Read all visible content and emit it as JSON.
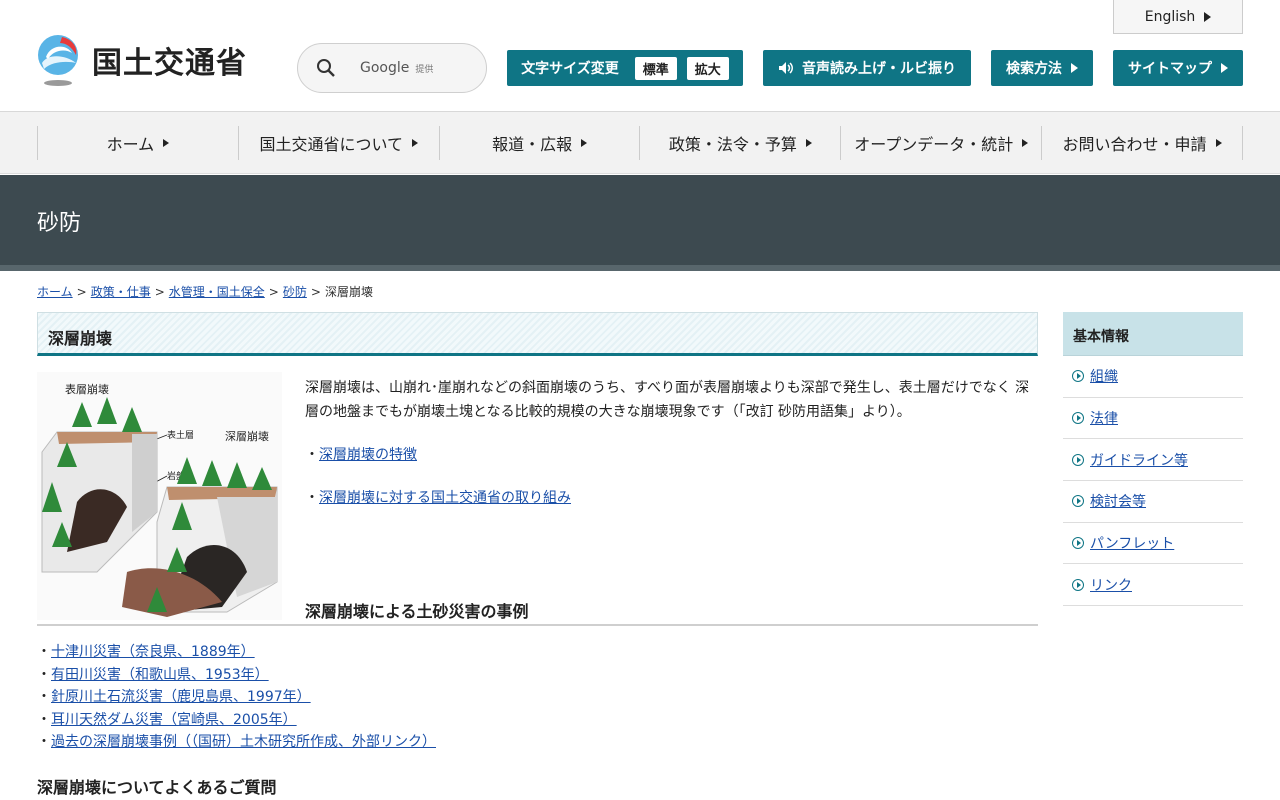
{
  "header": {
    "logo_text": "国土交通省",
    "search": {
      "brand": "Google",
      "provided": "提供"
    },
    "english_label": "English",
    "font_size": {
      "label": "文字サイズ変更",
      "standard": "標準",
      "large": "拡大"
    },
    "voice_label": "音声読み上げ・ルビ振り",
    "search_method_label": "検索方法",
    "sitemap_label": "サイトマップ"
  },
  "nav": {
    "items": [
      {
        "label": "ホーム"
      },
      {
        "label": "国土交通省について"
      },
      {
        "label": "報道・広報"
      },
      {
        "label": "政策・法令・予算"
      },
      {
        "label": "オープンデータ・統計"
      },
      {
        "label": "お問い合わせ・申請"
      }
    ]
  },
  "banner": {
    "title": "砂防"
  },
  "breadcrumb": {
    "items": [
      "ホーム",
      "政策・仕事",
      "水管理・国土保全",
      "砂防"
    ],
    "current": "深層崩壊",
    "separator": ">"
  },
  "main": {
    "title": "深層崩壊",
    "illustration": {
      "label_surface": "表層崩壊",
      "label_deep": "深層崩壊",
      "label_topsoil": "表土層",
      "label_bedrock": "岩盤"
    },
    "description": "深層崩壊は、山崩れ･崖崩れなどの斜面崩壊のうち、すべり面が表層崩壊よりも深部で発生し、表土層だけでなく 深層の地盤までもが崩壊土塊となる比較的規模の大きな崩壊現象です（「改訂 砂防用語集」より）。",
    "bullet": "・",
    "link_features": "深層崩壊の特徴",
    "link_efforts": "深層崩壊に対する国土交通省の取り組み",
    "cases_heading": "深層崩壊による土砂災害の事例",
    "cases": [
      "十津川災害（奈良県、1889年）",
      "有田川災害（和歌山県、1953年）",
      "針原川土石流災害（鹿児島県、1997年）",
      "耳川天然ダム災害（宮崎県、2005年）",
      "過去の深層崩壊事例（（国研）土木研究所作成、外部リンク）"
    ],
    "faq_heading": "深層崩壊についてよくあるご質問"
  },
  "sidebar": {
    "heading": "基本情報",
    "items": [
      "組織",
      "法律",
      "ガイドライン等",
      "検討会等",
      "パンフレット",
      "リンク"
    ]
  },
  "colors": {
    "teal": "#0f7585",
    "banner": "#3d4a50",
    "link": "#1a4fa8",
    "sidebar_head": "#c8e2e8"
  }
}
